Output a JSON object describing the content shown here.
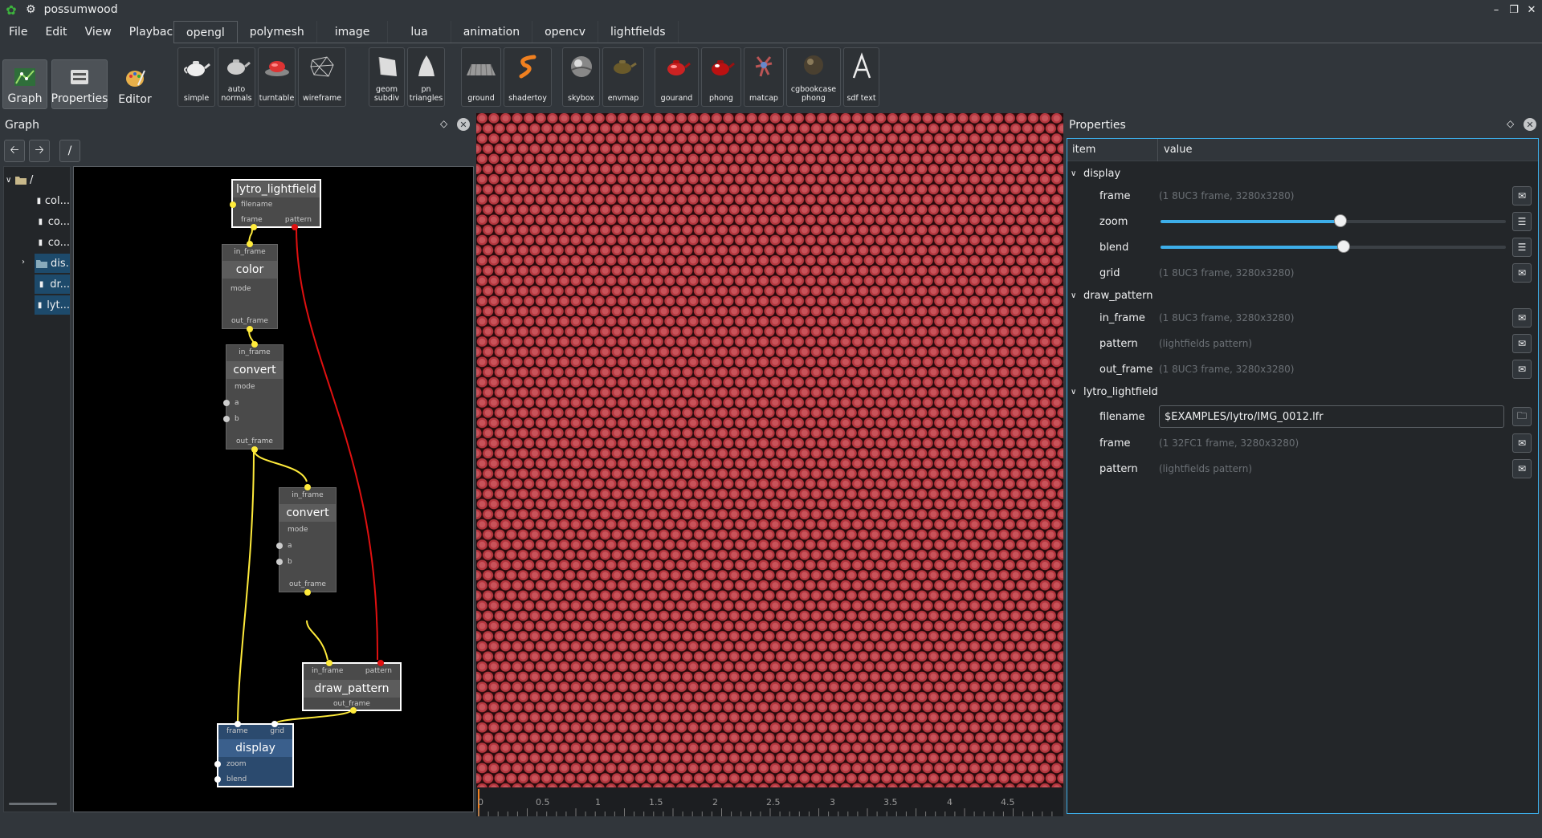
{
  "window": {
    "title": "possumwood"
  },
  "menu": [
    "File",
    "Edit",
    "View",
    "Playback"
  ],
  "big_buttons": [
    {
      "label": "Graph",
      "icon": "graph-icon",
      "active": true
    },
    {
      "label": "Properties",
      "icon": "properties-icon",
      "active": true
    },
    {
      "label": "Editor",
      "icon": "editor-icon",
      "active": false
    }
  ],
  "tabs": [
    "opengl",
    "polymesh",
    "image",
    "lua",
    "animation",
    "opencv",
    "lightfields"
  ],
  "active_tab": "opengl",
  "tools": [
    {
      "label": "simple",
      "icon": "teapot-icon"
    },
    {
      "label": "auto normals",
      "icon": "teapot-normals-icon"
    },
    {
      "label": "turntable",
      "icon": "turntable-icon"
    },
    {
      "label": "wireframe",
      "icon": "wireframe-icon"
    },
    {
      "label": "geom subdiv",
      "icon": "subdiv-icon"
    },
    {
      "label": "pn triangles",
      "icon": "cone-icon"
    },
    {
      "label": "ground",
      "icon": "ground-icon"
    },
    {
      "label": "shadertoy",
      "icon": "shadertoy-icon"
    },
    {
      "label": "skybox",
      "icon": "skybox-icon"
    },
    {
      "label": "envmap",
      "icon": "envmap-icon"
    },
    {
      "label": "gourand",
      "icon": "gourand-icon"
    },
    {
      "label": "phong",
      "icon": "phong-icon"
    },
    {
      "label": "matcap",
      "icon": "matcap-icon"
    },
    {
      "label": "cgbookcase phong",
      "icon": "cgbookcase-icon"
    },
    {
      "label": "sdf text",
      "icon": "sdf-text-icon"
    }
  ],
  "graph_panel": {
    "title": "Graph",
    "path": "/",
    "tree": [
      {
        "label": "/",
        "type": "folder",
        "selected": false
      },
      {
        "label": "col...",
        "type": "node",
        "selected": false
      },
      {
        "label": "co...",
        "type": "node",
        "selected": false
      },
      {
        "label": "co...",
        "type": "node",
        "selected": false
      },
      {
        "label": "dis...",
        "type": "folder",
        "selected": true
      },
      {
        "label": "dr...",
        "type": "node",
        "selected": true
      },
      {
        "label": "lyt...",
        "type": "node",
        "selected": true
      }
    ],
    "nodes": {
      "lytro": {
        "title": "lytro_lightfield",
        "ports": [
          "filename",
          "frame",
          "pattern"
        ]
      },
      "color": {
        "title": "color",
        "ports": [
          "in_frame",
          "mode",
          "out_frame"
        ]
      },
      "convert1": {
        "title": "convert",
        "ports": [
          "in_frame",
          "mode",
          "a",
          "b",
          "out_frame"
        ]
      },
      "convert2": {
        "title": "convert",
        "ports": [
          "in_frame",
          "mode",
          "a",
          "b",
          "out_frame"
        ]
      },
      "draw_pattern": {
        "title": "draw_pattern",
        "ports": [
          "in_frame",
          "pattern",
          "out_frame"
        ]
      },
      "display": {
        "title": "display",
        "ports": [
          "frame",
          "grid",
          "zoom",
          "blend"
        ]
      }
    }
  },
  "timeline": {
    "ticks": [
      "0",
      "0.5",
      "1",
      "1.5",
      "2",
      "2.5",
      "3",
      "3.5",
      "4",
      "4.5"
    ]
  },
  "properties_panel": {
    "title": "Properties",
    "col_item": "item",
    "col_value": "value",
    "groups": [
      {
        "name": "display",
        "rows": [
          {
            "name": "frame",
            "value": "(1 8UC3 frame, 3280x3280)"
          },
          {
            "name": "zoom",
            "value": "",
            "slider": 0.52
          },
          {
            "name": "blend",
            "value": "",
            "slider": 0.53
          },
          {
            "name": "grid",
            "value": "(1 8UC3 frame, 3280x3280)"
          }
        ]
      },
      {
        "name": "draw_pattern",
        "rows": [
          {
            "name": "in_frame",
            "value": "(1 8UC3 frame, 3280x3280)"
          },
          {
            "name": "pattern",
            "value": "(lightfields pattern)"
          },
          {
            "name": "out_frame",
            "value": "(1 8UC3 frame, 3280x3280)"
          }
        ]
      },
      {
        "name": "lytro_lightfield",
        "rows": [
          {
            "name": "filename",
            "value": "$EXAMPLES/lytro/IMG_0012.lfr"
          },
          {
            "name": "frame",
            "value": "(1 32FC1 frame, 3280x3280)"
          },
          {
            "name": "pattern",
            "value": "(lightfields pattern)"
          }
        ]
      }
    ]
  },
  "colors": {
    "accent": "#3daee9",
    "background": "#31363b",
    "link_yellow": "#ffeb3b",
    "link_red": "#e01010",
    "viewport_red": "#b5363e"
  }
}
